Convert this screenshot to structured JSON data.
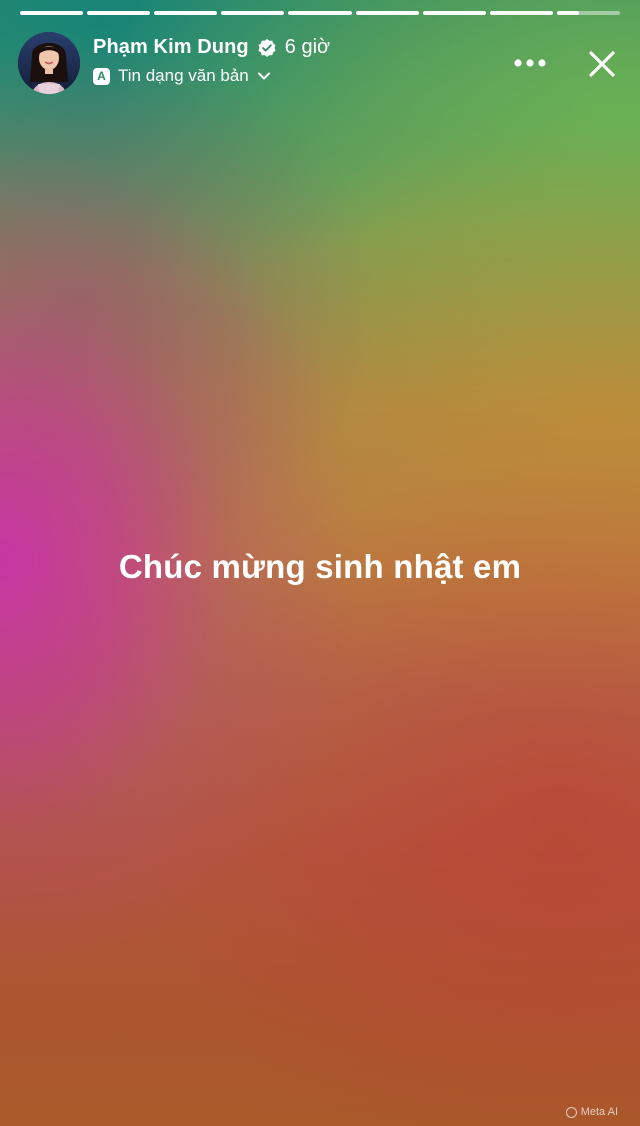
{
  "progress": {
    "segments": [
      1,
      1,
      1,
      1,
      1,
      1,
      1,
      1,
      0.35
    ],
    "colors": {
      "filled": "#ffffff",
      "track": "rgba(255,255,255,0.45)"
    }
  },
  "header": {
    "author_name": "Phạm Kim Dung",
    "verified_icon": "verified-badge-icon",
    "time_ago": "6 giờ",
    "type_icon_letter": "A",
    "story_type": "Tin dạng văn bản",
    "more_icon": "more-horizontal-icon",
    "close_icon": "close-icon"
  },
  "story": {
    "text": "Chúc mừng sinh nhật em"
  },
  "watermark": {
    "label": "Meta AI"
  },
  "theme": {
    "text_color": "#ffffff",
    "accent_teal": "#2e8a6c",
    "accent_magenta": "#c832aa",
    "accent_orange": "#b97a42"
  }
}
